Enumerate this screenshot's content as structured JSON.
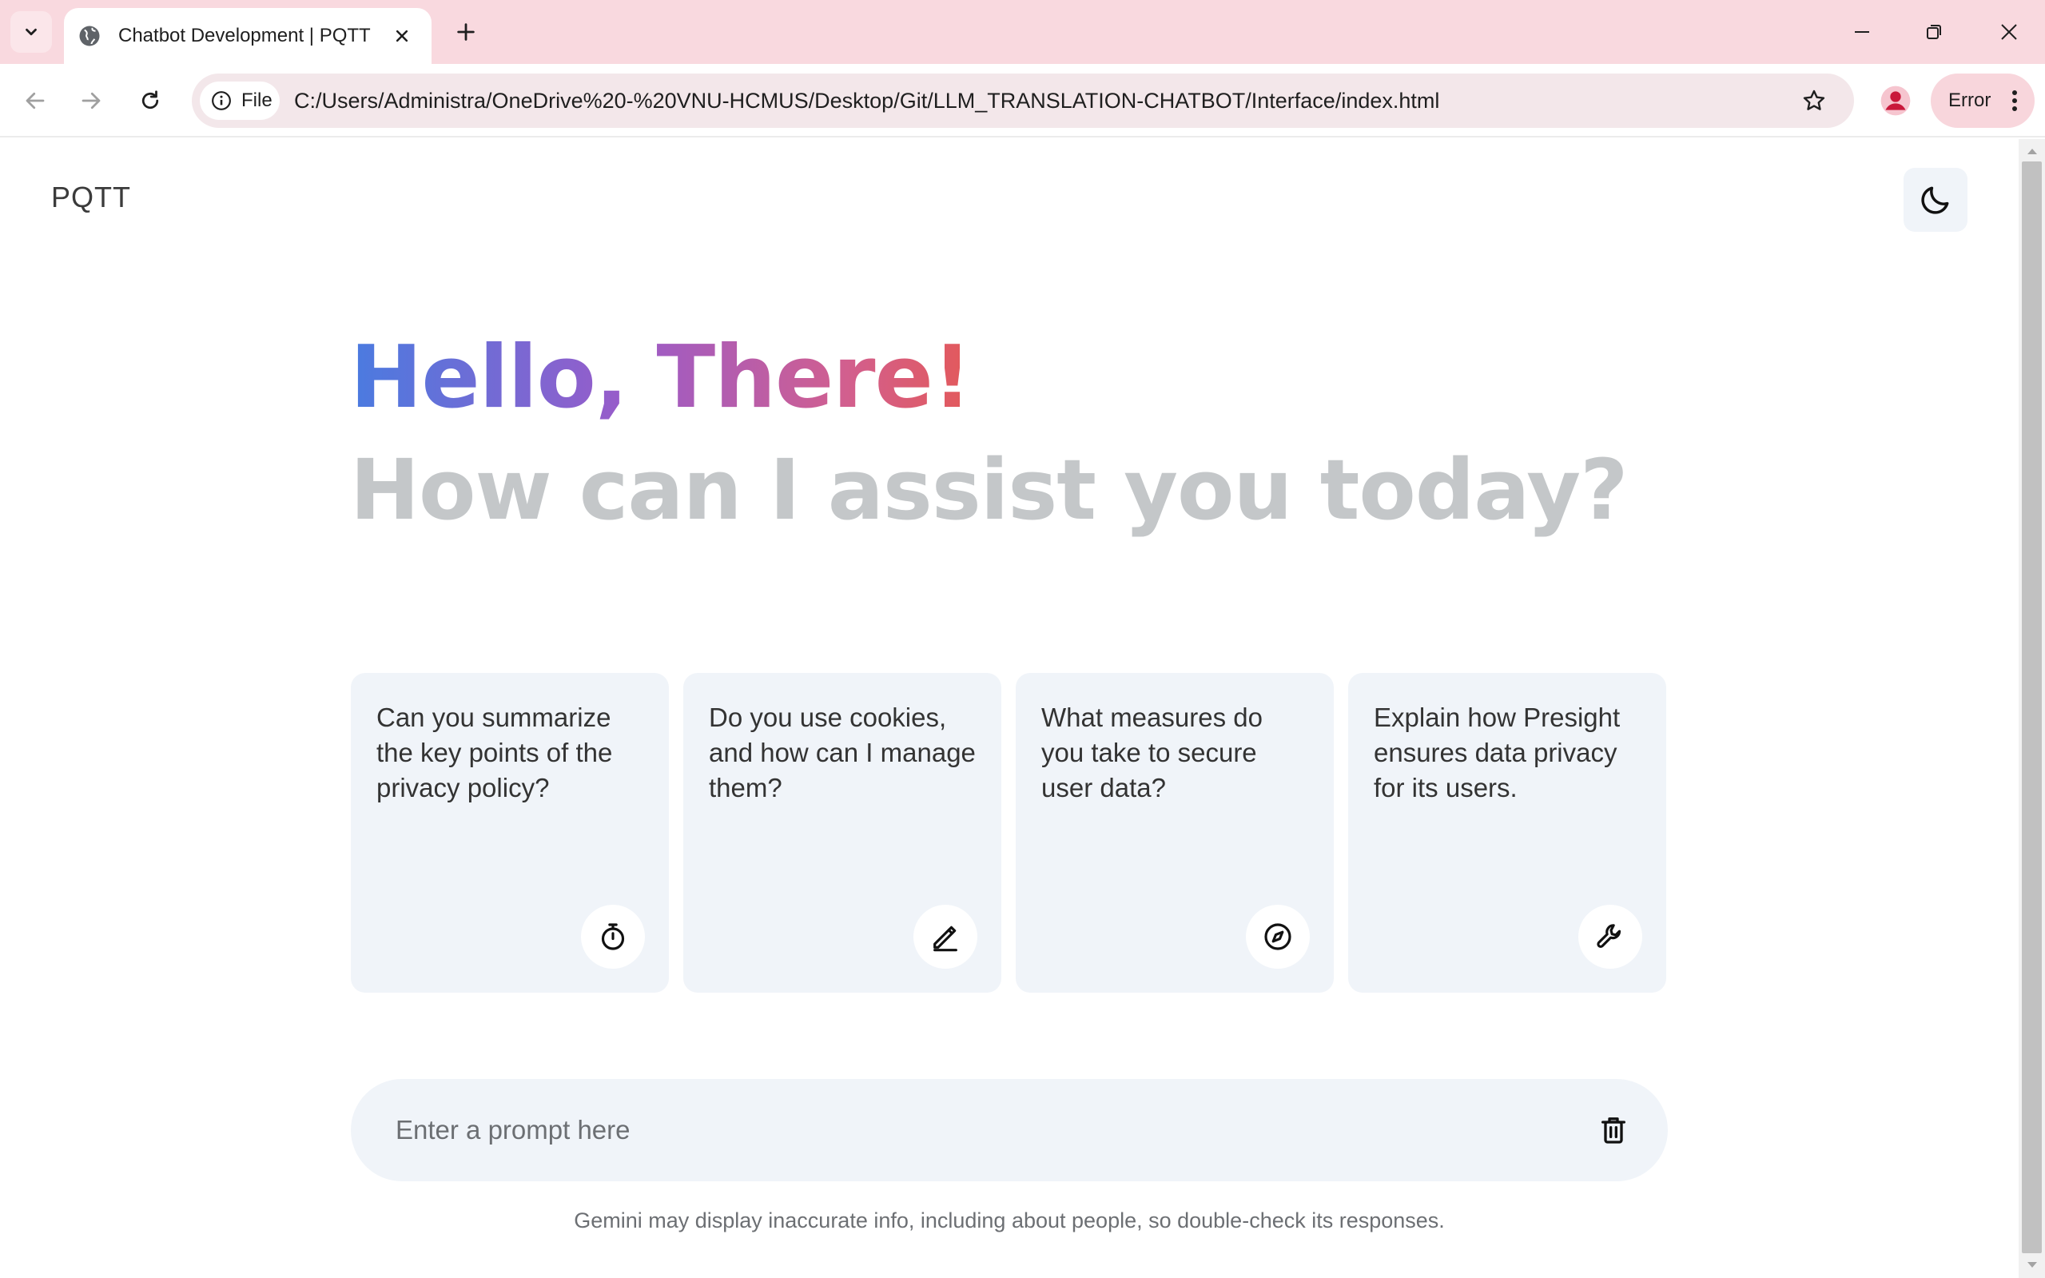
{
  "browser": {
    "tab_title": "Chatbot Development | PQTT",
    "url": "C:/Users/Administra/OneDrive%20-%20VNU-HCMUS/Desktop/Git/LLM_TRANSLATION-CHATBOT/Interface/index.html",
    "site_chip_label": "File",
    "error_label": "Error",
    "icons": {
      "tab_search": "chevron-down-icon",
      "favicon": "globe-icon",
      "close": "close-icon",
      "new_tab": "plus-icon",
      "back": "back-arrow-icon",
      "forward": "forward-arrow-icon",
      "reload": "reload-icon",
      "info": "info-icon",
      "bookmark": "star-icon",
      "profile": "profile-icon",
      "menu": "kebab-menu-icon"
    }
  },
  "header": {
    "brand": "PQTT",
    "theme_toggle_icon": "moon-icon"
  },
  "hero": {
    "greeting": "Hello, There!",
    "subtitle": "How can I assist you today?",
    "gradient_colors": [
      "#4a7be0",
      "#9a5bc9",
      "#d25f8e",
      "#e3595a"
    ]
  },
  "suggestions": [
    {
      "text": "Can you summarize the key points of the privacy policy?",
      "icon": "timer-icon"
    },
    {
      "text": "Do you use cookies, and how can I manage them?",
      "icon": "pencil-icon"
    },
    {
      "text": "What measures do you take to secure user data?",
      "icon": "compass-icon"
    },
    {
      "text": "Explain how Presight ensures data privacy for its users.",
      "icon": "wrench-icon"
    }
  ],
  "prompt": {
    "placeholder": "Enter a prompt here",
    "value": "",
    "delete_icon": "trash-icon"
  },
  "footer": {
    "disclaimer": "Gemini may display inaccurate info, including about people, so double-check its responses."
  },
  "colors": {
    "tabbar_bg": "#f9d9df",
    "card_bg": "#f0f4f9",
    "subtitle": "#c4c7c9"
  }
}
